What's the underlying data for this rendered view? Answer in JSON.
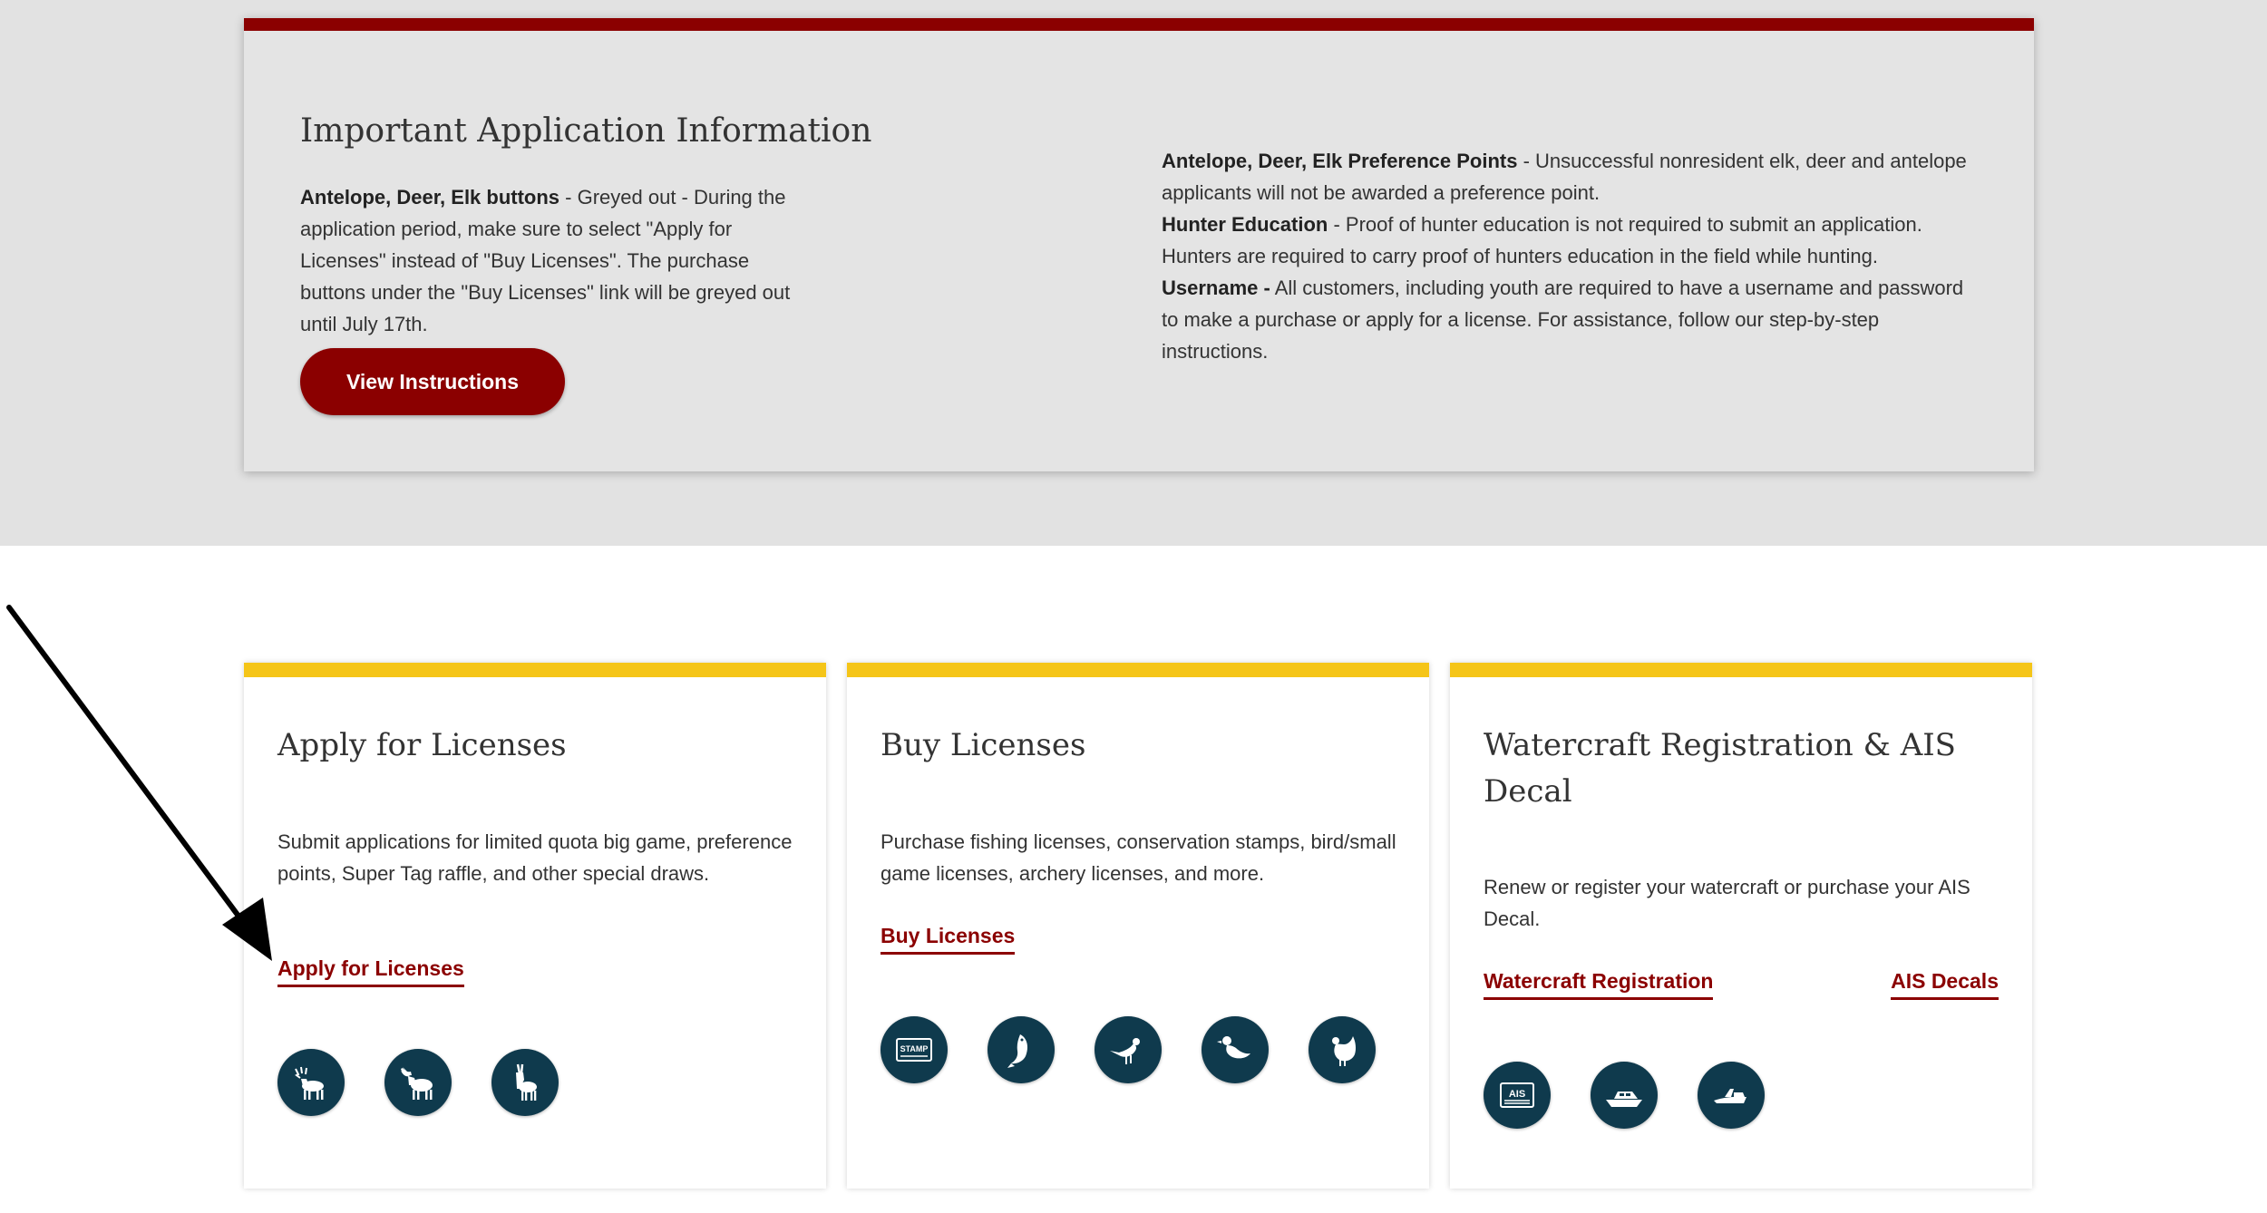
{
  "info": {
    "heading": "Important Application Information",
    "left": {
      "bold": "Antelope, Deer, Elk buttons",
      "text": " - Greyed out - During the application period, make sure to select \"Apply for Licenses\" instead of \"Buy Licenses\".  The purchase buttons under the \"Buy Licenses\" link will be greyed out until July 17th."
    },
    "button_label": "View Instructions",
    "right": [
      {
        "bold": "Antelope, Deer, Elk Preference Points",
        "text": " - Unsuccessful nonresident elk, deer and antelope applicants will not be awarded a preference point."
      },
      {
        "bold": "Hunter Education",
        "text": " - Proof of hunter education is not required to submit an application. Hunters are required to carry proof of hunters education in the field while hunting."
      },
      {
        "bold": "Username -",
        "text": " All customers, including youth are required to have a username and password to make a purchase or apply for a license. For assistance, follow our step-by-step instructions."
      }
    ]
  },
  "cards": [
    {
      "title": "Apply for Licenses",
      "description": "Submit applications for limited quota big game, preference points, Super Tag raffle, and other special draws.",
      "link": "Apply for Licenses",
      "icons": [
        "elk-icon",
        "moose-icon",
        "antelope-icon"
      ]
    },
    {
      "title": "Buy Licenses",
      "description": "Purchase fishing licenses, conservation stamps, bird/small game licenses, archery licenses, and more.",
      "link": "Buy Licenses",
      "icons": [
        "stamp-icon",
        "fish-icon",
        "pheasant-icon",
        "duck-icon",
        "grouse-icon"
      ],
      "stamp_label": "STAMP"
    },
    {
      "title": "Watercraft Registration & AIS Decal",
      "description": "Renew or register your watercraft or purchase your AIS Decal.",
      "links": [
        "Watercraft Registration",
        "AIS Decals"
      ],
      "icons": [
        "ais-decal-icon",
        "boat-icon",
        "jet-ski-icon"
      ],
      "ais_label": "AIS"
    }
  ],
  "colors": {
    "brand_red": "#8b0000",
    "accent_yellow": "#f5c518",
    "icon_navy": "#0f3a4d"
  }
}
